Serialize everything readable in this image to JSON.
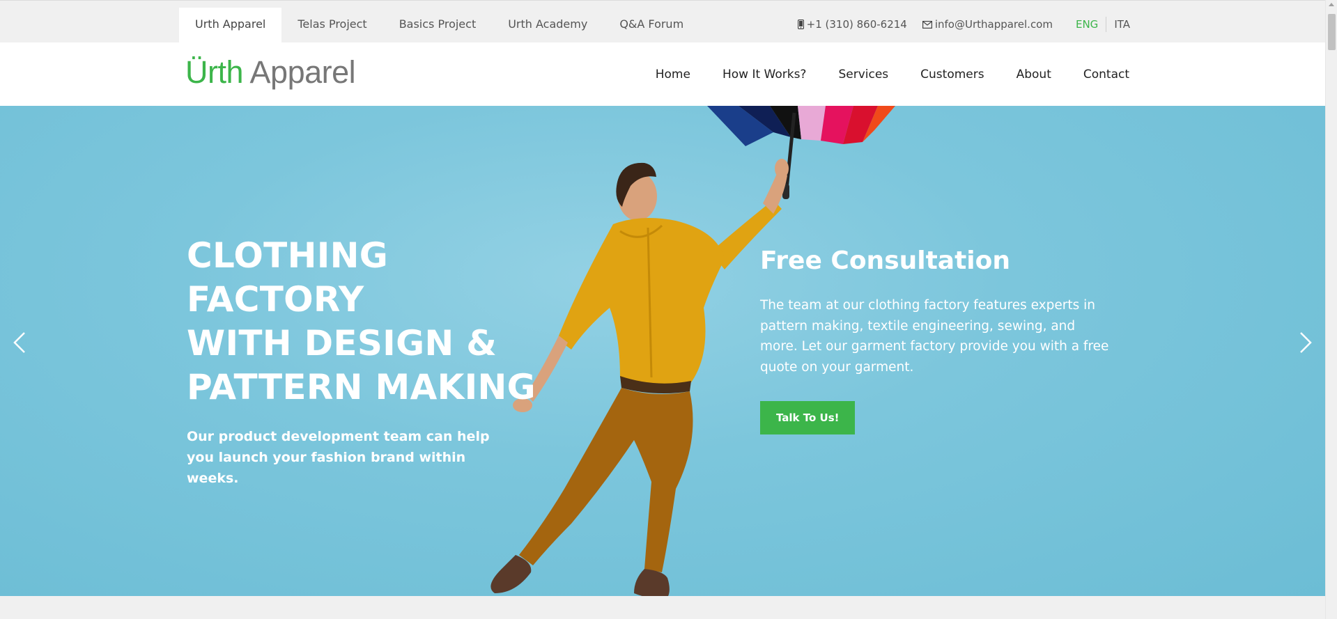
{
  "topbar": {
    "tabs": [
      {
        "label": "Urth Apparel",
        "active": true
      },
      {
        "label": "Telas Project",
        "active": false
      },
      {
        "label": "Basics Project",
        "active": false
      },
      {
        "label": "Urth Academy",
        "active": false
      },
      {
        "label": "Q&A Forum",
        "active": false
      }
    ],
    "phone": "+1 (310) 860-6214",
    "email": "info@Urthapparel.com",
    "languages": [
      {
        "label": "ENG",
        "active": true
      },
      {
        "label": "ITA",
        "active": false
      }
    ]
  },
  "header": {
    "logo_part1": "Ürth",
    "logo_part2": "Apparel",
    "nav": [
      "Home",
      "How It Works?",
      "Services",
      "Customers",
      "About",
      "Contact"
    ]
  },
  "hero": {
    "title_lines": [
      "CLOTHING FACTORY",
      "WITH DESIGN &",
      "PATTERN MAKING"
    ],
    "subtitle": "Our product development team can help you launch your fashion brand within weeks.",
    "consult_title": "Free Consultation",
    "consult_text": "The team at our clothing factory features experts in pattern making, textile engineering, sewing, and more. Let our garment factory provide you with a free quote on your garment.",
    "cta_label": "Talk To Us!"
  },
  "colors": {
    "accent": "#3cb54a",
    "hero_bg": "#7cc6dc",
    "shirt": "#e0a312",
    "pants": "#a4650f"
  },
  "icons": {
    "phone": "phone-icon",
    "email": "envelope-icon",
    "prev": "chevron-left-icon",
    "next": "chevron-right-icon"
  }
}
